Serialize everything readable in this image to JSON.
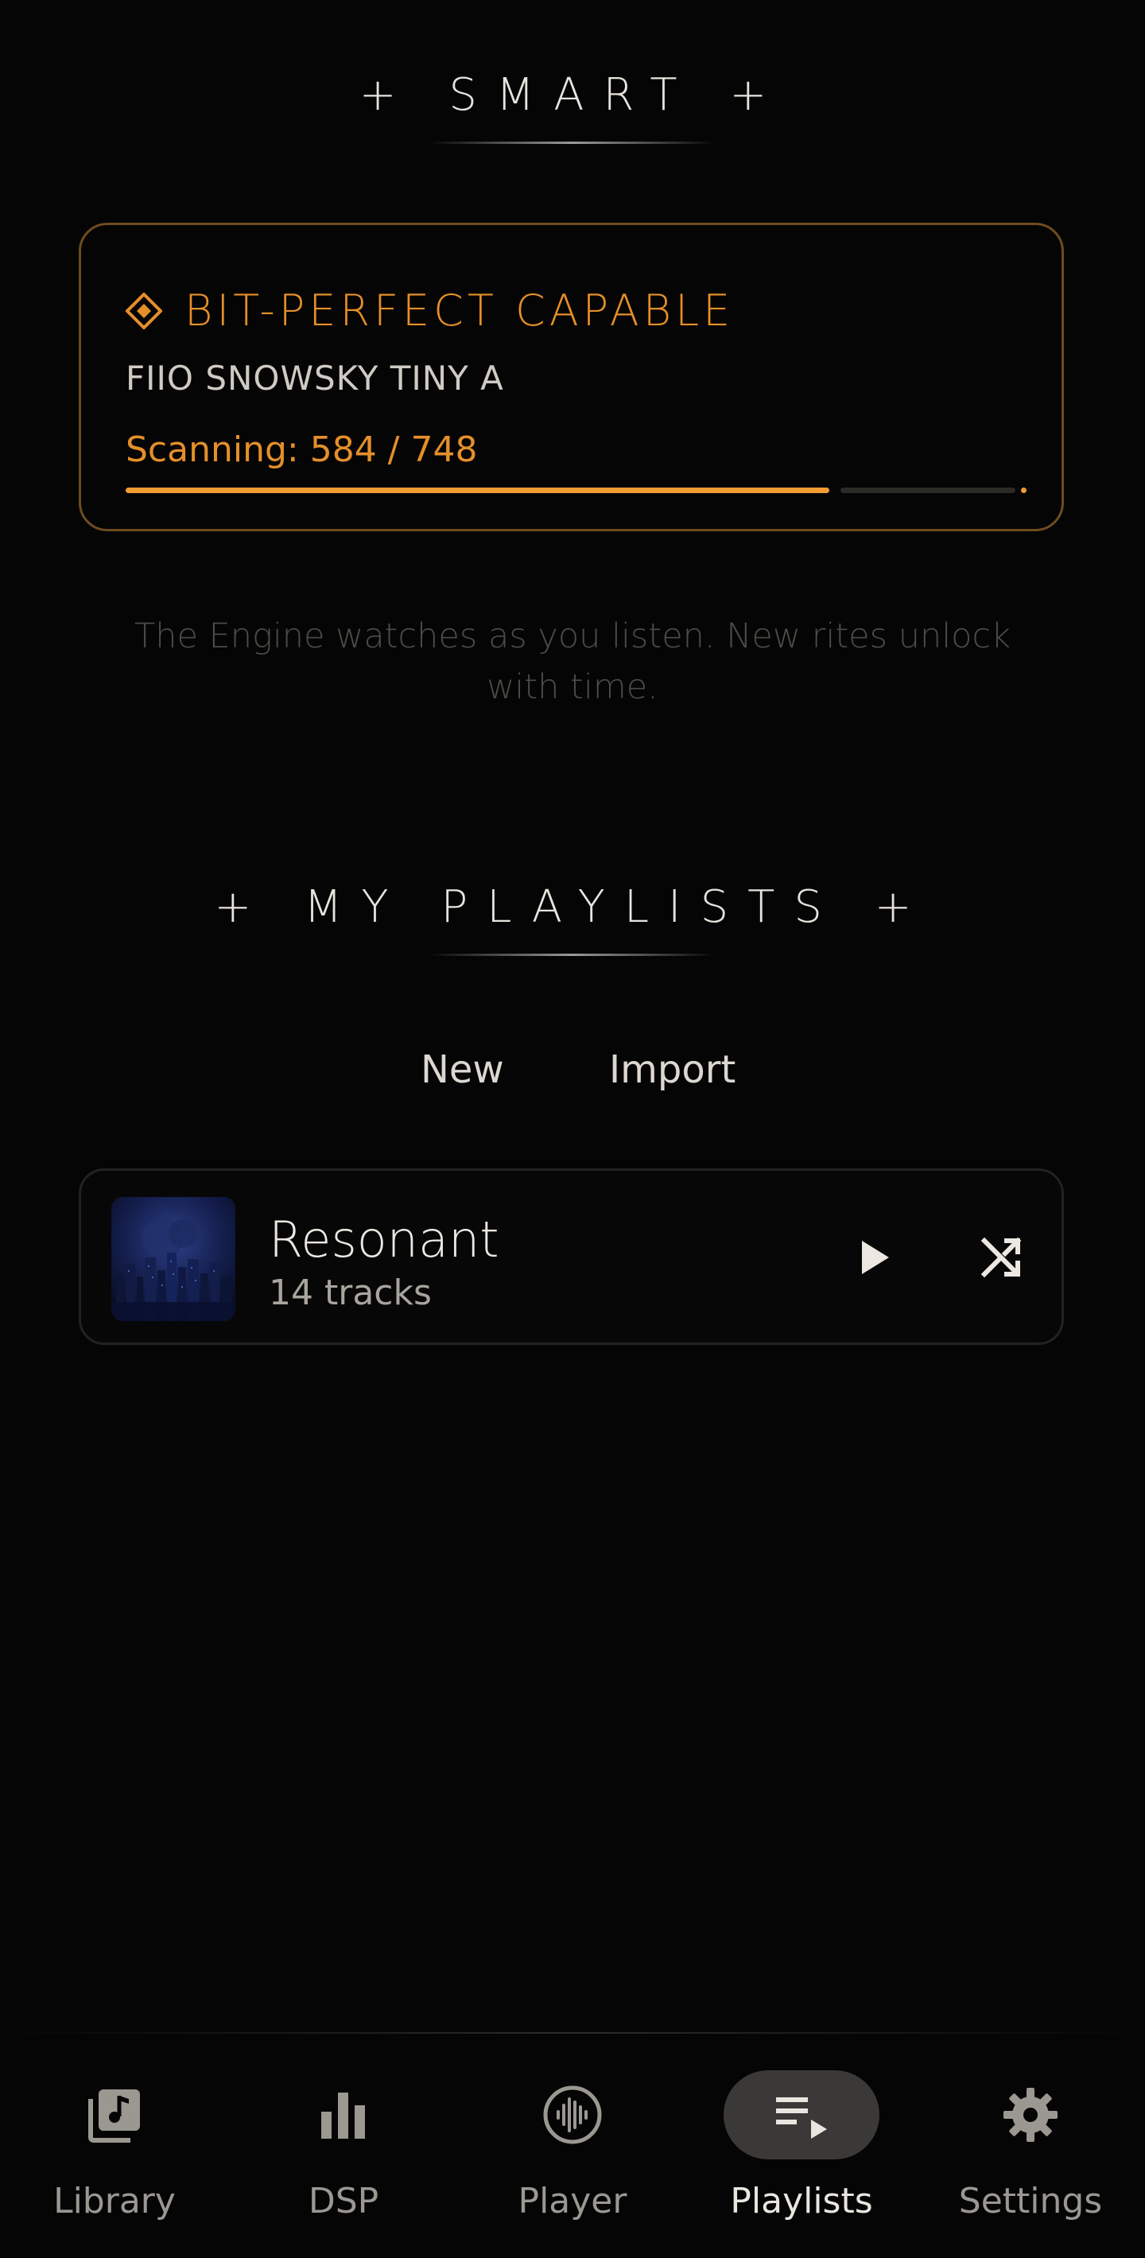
{
  "smart": {
    "title": "+ SMART +"
  },
  "device_card": {
    "status": "BIT-PERFECT CAPABLE",
    "device": "FIIO SNOWSKY TINY A",
    "scan_text": "Scanning: 584 / 748",
    "scanned": 584,
    "total": 748,
    "accent_color": "#e58f2a",
    "icon": "diamond-icon"
  },
  "engine_note": "The Engine watches as you listen. New rites unlock with time.",
  "playlists": {
    "title": "+ MY PLAYLISTS +",
    "new_label": "New",
    "import_label": "Import",
    "items": [
      {
        "name": "Resonant",
        "count": "14 tracks",
        "art_icon": "city-night-artwork",
        "play_icon": "play-icon",
        "shuffle_icon": "shuffle-icon"
      }
    ]
  },
  "nav": {
    "items": [
      {
        "label": "Library",
        "icon": "library-music-icon",
        "active": false
      },
      {
        "label": "DSP",
        "icon": "bar-chart-icon",
        "active": false
      },
      {
        "label": "Player",
        "icon": "waveform-disc-icon",
        "active": false
      },
      {
        "label": "Playlists",
        "icon": "playlist-play-icon",
        "active": true
      },
      {
        "label": "Settings",
        "icon": "gear-icon",
        "active": false
      }
    ]
  }
}
